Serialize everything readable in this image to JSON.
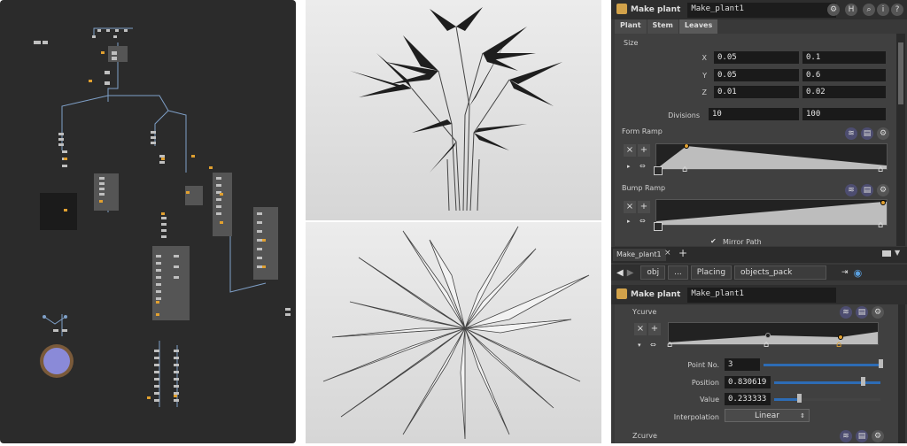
{
  "params_top": {
    "node_type": "Make plant",
    "node_name": "Make_plant1",
    "tabs": [
      "Plant",
      "Stem",
      "Leaves"
    ],
    "size_section": "Size",
    "size": {
      "x_label": "X",
      "x_min": "0.05",
      "x_max": "0.1",
      "y_label": "Y",
      "y_min": "0.05",
      "y_max": "0.6",
      "z_label": "Z",
      "z_min": "0.01",
      "z_max": "0.02"
    },
    "divisions_label": "Divisions",
    "divisions_min": "10",
    "divisions_max": "100",
    "form_ramp_label": "Form Ramp",
    "bump_ramp_label": "Bump Ramp",
    "mirror_path_label": "Mirror Path"
  },
  "pane_tab": {
    "label": "Make_plant1",
    "close": "×",
    "add": "+"
  },
  "path_bar": {
    "items": [
      "obj",
      "...",
      "Placing",
      "objects_pack"
    ]
  },
  "params_bottom": {
    "node_type": "Make plant",
    "node_name": "Make_plant1",
    "ycurve_label": "Ycurve",
    "point_no_label": "Point No.",
    "point_no_value": "3",
    "position_label": "Position",
    "position_value": "0.830619",
    "value_label": "Value",
    "value_value": "0.233333",
    "interpolation_label": "Interpolation",
    "interpolation_value": "Linear",
    "zcurve_label": "Zcurve"
  },
  "header_icons": [
    "gear-icon",
    "help-h-icon",
    "search-icon",
    "info-icon",
    "question-icon"
  ],
  "colors": {
    "network_bg": "#2b2b2b",
    "panel_bg": "#393939",
    "field_bg": "#1a1a1a",
    "accent_orange": "#e0a030",
    "slider_blue": "#2d6cb5"
  }
}
